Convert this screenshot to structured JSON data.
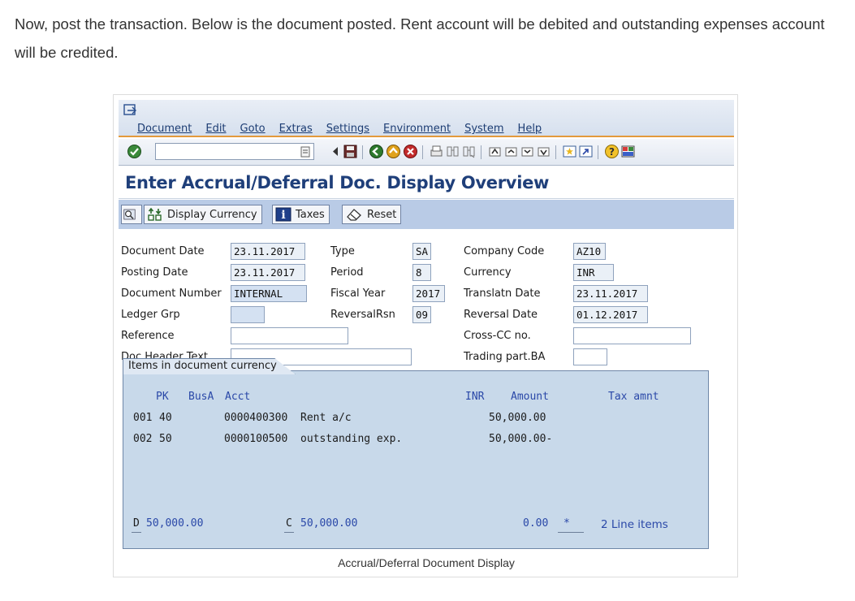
{
  "intro": "Now, post the transaction. Below is the document posted. Rent account will be debited and outstanding expenses account will be credited.",
  "menu": [
    "Document",
    "Edit",
    "Goto",
    "Extras",
    "Settings",
    "Environment",
    "System",
    "Help"
  ],
  "title": "Enter Accrual/Deferral Doc. Display Overview",
  "buttons": {
    "display_currency": "Display Currency",
    "taxes": "Taxes",
    "reset": "Reset"
  },
  "header": {
    "document_date_label": "Document Date",
    "document_date": "23.11.2017",
    "posting_date_label": "Posting Date",
    "posting_date": "23.11.2017",
    "document_number_label": "Document Number",
    "document_number": "INTERNAL",
    "ledger_grp_label": "Ledger Grp",
    "ledger_grp": "",
    "reference_label": "Reference",
    "reference": "",
    "doc_header_text_label": "Doc.Header Text",
    "doc_header_text": "",
    "type_label": "Type",
    "type": "SA",
    "period_label": "Period",
    "period": "8",
    "fiscal_year_label": "Fiscal Year",
    "fiscal_year": "2017",
    "reversal_rsn_label": "ReversalRsn",
    "reversal_rsn": "09",
    "company_code_label": "Company Code",
    "company_code": "AZ10",
    "currency_label": "Currency",
    "currency": "INR",
    "translatn_date_label": "Translatn Date",
    "translatn_date": "23.11.2017",
    "reversal_date_label": "Reversal Date",
    "reversal_date": "01.12.2017",
    "cross_cc_label": "Cross-CC no.",
    "cross_cc": "",
    "trading_part_label": "Trading part.BA",
    "trading_part": ""
  },
  "items": {
    "tab_label": "Items in document currency",
    "col_pk": "PK",
    "col_busa": "BusA",
    "col_acct": "Acct",
    "col_curr": "INR",
    "col_amount": "Amount",
    "col_tax": "Tax amnt",
    "rows": [
      {
        "no": "001",
        "pk": "40",
        "acct": "0000400300",
        "text": "Rent a/c",
        "amount": "50,000.00"
      },
      {
        "no": "002",
        "pk": "50",
        "acct": "0000100500",
        "text": "outstanding exp.",
        "amount": "50,000.00-"
      }
    ],
    "debit_prefix": "D",
    "debit_total": "50,000.00",
    "credit_prefix": "C",
    "credit_total": "50,000.00",
    "balance": "0.00",
    "balance_flag": "*",
    "line_items": "2 Line items"
  },
  "caption": "Accrual/Deferral Document Display"
}
